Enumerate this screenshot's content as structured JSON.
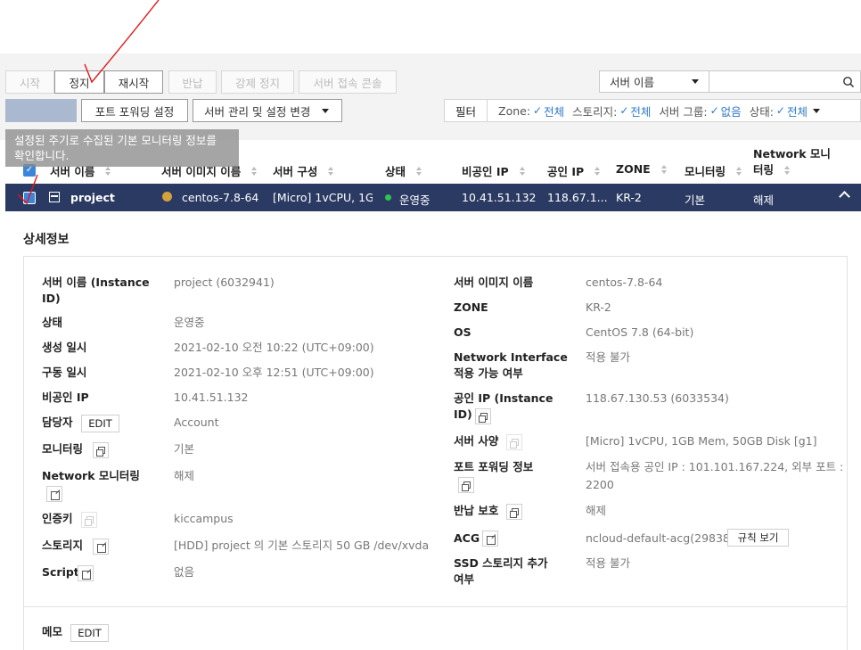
{
  "toolbar": {
    "start": "시작",
    "stop": "정지",
    "restart": "재시작",
    "return": "반납",
    "force_stop": "강제 정지",
    "console": "서버 접속 콘솔",
    "create": "",
    "port_forwarding": "포트 포워딩 설정",
    "manage": "서버 관리 및 설정 변경"
  },
  "search": {
    "field": "서버 이름",
    "value": ""
  },
  "filter": {
    "label": "필터",
    "zone_key": "Zone:",
    "zone_val": "전체",
    "storage_key": "스토리지:",
    "storage_val": "전체",
    "group_key": "서버 그룹:",
    "group_val": "없음",
    "status_key": "상태:",
    "status_val": "전체"
  },
  "tooltip": {
    "line1": "설정된 주기로 수집된 기본 모니터링 정보를",
    "line2": "확인합니다."
  },
  "table": {
    "headers": {
      "name": "서버 이름",
      "image": "서버 이미지 이름",
      "spec": "서버 구성",
      "status": "상태",
      "private_ip": "비공인 IP",
      "public_ip": "공인 IP",
      "zone": "ZONE",
      "monitoring": "모니터링",
      "netmon_1": "Network 모니",
      "netmon_2": "터링"
    },
    "row": {
      "name": "project",
      "image": "centos-7.8-64",
      "spec": "[Micro] 1vCPU, 1G...",
      "status": "운영중",
      "private_ip": "10.41.51.132",
      "public_ip": "118.67.1...",
      "zone": "KR-2",
      "monitoring": "기본",
      "netmon": "해제"
    }
  },
  "detail": {
    "title": "상세정보",
    "left": {
      "name_label_1": "서버 이름 (Instance",
      "name_label_2": "ID)",
      "name_val": "project (6032941)",
      "status_label": "상태",
      "status_val": "운영중",
      "created_label": "생성 일시",
      "created_val": "2021-02-10 오전 10:22 (UTC+09:00)",
      "started_label": "구동 일시",
      "started_val": "2021-02-10 오후 12:51 (UTC+09:00)",
      "private_ip_label": "비공인 IP",
      "private_ip_val": "10.41.51.132",
      "owner_label": "담당자",
      "owner_edit": "EDIT",
      "owner_val": "Account",
      "monitoring_label": "모니터링",
      "monitoring_val": "기본",
      "netmon_label": "Network 모니터링",
      "netmon_val": "해제",
      "authkey_label": "인증키",
      "authkey_val": "kiccampus",
      "storage_label": "스토리지",
      "storage_val": "[HDD] project 의 기본 스토리지  50 GB /dev/xvda",
      "script_label": "Script",
      "script_val": "없음"
    },
    "right": {
      "image_label": "서버 이미지 이름",
      "image_val": "centos-7.8-64",
      "zone_label": "ZONE",
      "zone_val": "KR-2",
      "os_label": "OS",
      "os_val": "CentOS 7.8 (64-bit)",
      "ni_label_1": "Network Interface",
      "ni_label_2": "적용 가능 여부",
      "ni_val": "적용 불가",
      "pubip_label_1": "공인 IP (Instance",
      "pubip_label_2": "ID)",
      "pubip_val": "118.67.130.53 (6033534)",
      "spec_label": "서버 사양",
      "spec_val": "[Micro] 1vCPU, 1GB Mem, 50GB Disk [g1]",
      "pf_label": "포트 포워딩 정보",
      "pf_val_1": "서버 접속용 공인 IP : 101.101.167.224, 외부 포트 :",
      "pf_val_2": "2200",
      "return_label": "반납 보호",
      "return_val": "해제",
      "acg_label": "ACG",
      "acg_val": "ncloud-default-acg(298384)",
      "acg_btn": "규칙 보기",
      "ssd_label_1": "SSD 스토리지 추가",
      "ssd_label_2": "여부",
      "ssd_val": "적용 불가"
    },
    "memo_label": "메모",
    "memo_edit": "EDIT"
  },
  "colors": {
    "selected_row": "#2b3a63",
    "accent": "#3b86d8",
    "running": "#2dc651",
    "annotation": "#e0151a"
  }
}
